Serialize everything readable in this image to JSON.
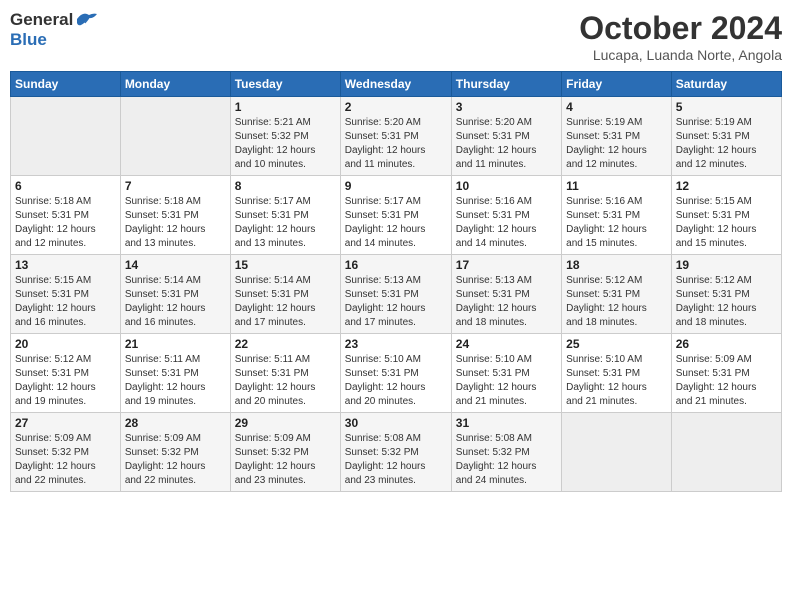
{
  "header": {
    "logo_general": "General",
    "logo_blue": "Blue",
    "month": "October 2024",
    "location": "Lucapa, Luanda Norte, Angola"
  },
  "days_of_week": [
    "Sunday",
    "Monday",
    "Tuesday",
    "Wednesday",
    "Thursday",
    "Friday",
    "Saturday"
  ],
  "weeks": [
    [
      {
        "day": "",
        "info": ""
      },
      {
        "day": "",
        "info": ""
      },
      {
        "day": "1",
        "info": "Sunrise: 5:21 AM\nSunset: 5:32 PM\nDaylight: 12 hours\nand 10 minutes."
      },
      {
        "day": "2",
        "info": "Sunrise: 5:20 AM\nSunset: 5:31 PM\nDaylight: 12 hours\nand 11 minutes."
      },
      {
        "day": "3",
        "info": "Sunrise: 5:20 AM\nSunset: 5:31 PM\nDaylight: 12 hours\nand 11 minutes."
      },
      {
        "day": "4",
        "info": "Sunrise: 5:19 AM\nSunset: 5:31 PM\nDaylight: 12 hours\nand 12 minutes."
      },
      {
        "day": "5",
        "info": "Sunrise: 5:19 AM\nSunset: 5:31 PM\nDaylight: 12 hours\nand 12 minutes."
      }
    ],
    [
      {
        "day": "6",
        "info": "Sunrise: 5:18 AM\nSunset: 5:31 PM\nDaylight: 12 hours\nand 12 minutes."
      },
      {
        "day": "7",
        "info": "Sunrise: 5:18 AM\nSunset: 5:31 PM\nDaylight: 12 hours\nand 13 minutes."
      },
      {
        "day": "8",
        "info": "Sunrise: 5:17 AM\nSunset: 5:31 PM\nDaylight: 12 hours\nand 13 minutes."
      },
      {
        "day": "9",
        "info": "Sunrise: 5:17 AM\nSunset: 5:31 PM\nDaylight: 12 hours\nand 14 minutes."
      },
      {
        "day": "10",
        "info": "Sunrise: 5:16 AM\nSunset: 5:31 PM\nDaylight: 12 hours\nand 14 minutes."
      },
      {
        "day": "11",
        "info": "Sunrise: 5:16 AM\nSunset: 5:31 PM\nDaylight: 12 hours\nand 15 minutes."
      },
      {
        "day": "12",
        "info": "Sunrise: 5:15 AM\nSunset: 5:31 PM\nDaylight: 12 hours\nand 15 minutes."
      }
    ],
    [
      {
        "day": "13",
        "info": "Sunrise: 5:15 AM\nSunset: 5:31 PM\nDaylight: 12 hours\nand 16 minutes."
      },
      {
        "day": "14",
        "info": "Sunrise: 5:14 AM\nSunset: 5:31 PM\nDaylight: 12 hours\nand 16 minutes."
      },
      {
        "day": "15",
        "info": "Sunrise: 5:14 AM\nSunset: 5:31 PM\nDaylight: 12 hours\nand 17 minutes."
      },
      {
        "day": "16",
        "info": "Sunrise: 5:13 AM\nSunset: 5:31 PM\nDaylight: 12 hours\nand 17 minutes."
      },
      {
        "day": "17",
        "info": "Sunrise: 5:13 AM\nSunset: 5:31 PM\nDaylight: 12 hours\nand 18 minutes."
      },
      {
        "day": "18",
        "info": "Sunrise: 5:12 AM\nSunset: 5:31 PM\nDaylight: 12 hours\nand 18 minutes."
      },
      {
        "day": "19",
        "info": "Sunrise: 5:12 AM\nSunset: 5:31 PM\nDaylight: 12 hours\nand 18 minutes."
      }
    ],
    [
      {
        "day": "20",
        "info": "Sunrise: 5:12 AM\nSunset: 5:31 PM\nDaylight: 12 hours\nand 19 minutes."
      },
      {
        "day": "21",
        "info": "Sunrise: 5:11 AM\nSunset: 5:31 PM\nDaylight: 12 hours\nand 19 minutes."
      },
      {
        "day": "22",
        "info": "Sunrise: 5:11 AM\nSunset: 5:31 PM\nDaylight: 12 hours\nand 20 minutes."
      },
      {
        "day": "23",
        "info": "Sunrise: 5:10 AM\nSunset: 5:31 PM\nDaylight: 12 hours\nand 20 minutes."
      },
      {
        "day": "24",
        "info": "Sunrise: 5:10 AM\nSunset: 5:31 PM\nDaylight: 12 hours\nand 21 minutes."
      },
      {
        "day": "25",
        "info": "Sunrise: 5:10 AM\nSunset: 5:31 PM\nDaylight: 12 hours\nand 21 minutes."
      },
      {
        "day": "26",
        "info": "Sunrise: 5:09 AM\nSunset: 5:31 PM\nDaylight: 12 hours\nand 21 minutes."
      }
    ],
    [
      {
        "day": "27",
        "info": "Sunrise: 5:09 AM\nSunset: 5:32 PM\nDaylight: 12 hours\nand 22 minutes."
      },
      {
        "day": "28",
        "info": "Sunrise: 5:09 AM\nSunset: 5:32 PM\nDaylight: 12 hours\nand 22 minutes."
      },
      {
        "day": "29",
        "info": "Sunrise: 5:09 AM\nSunset: 5:32 PM\nDaylight: 12 hours\nand 23 minutes."
      },
      {
        "day": "30",
        "info": "Sunrise: 5:08 AM\nSunset: 5:32 PM\nDaylight: 12 hours\nand 23 minutes."
      },
      {
        "day": "31",
        "info": "Sunrise: 5:08 AM\nSunset: 5:32 PM\nDaylight: 12 hours\nand 24 minutes."
      },
      {
        "day": "",
        "info": ""
      },
      {
        "day": "",
        "info": ""
      }
    ]
  ]
}
